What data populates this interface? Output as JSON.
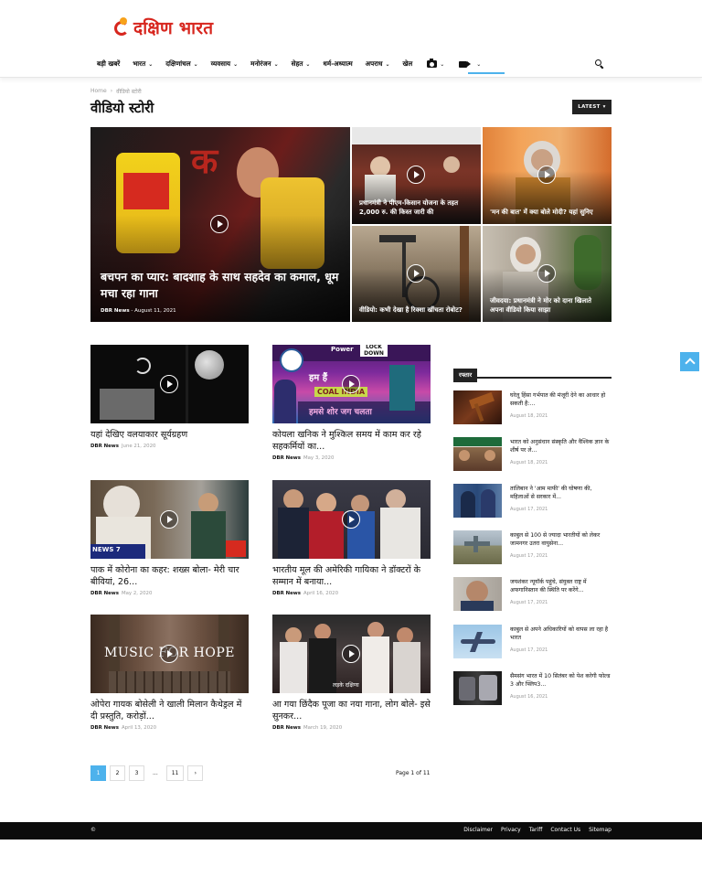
{
  "site": {
    "logo_text": "दक्षिण भारत"
  },
  "nav": {
    "items": [
      {
        "label": "बड़ी खबरें",
        "caret": false
      },
      {
        "label": "भारत",
        "caret": true
      },
      {
        "label": "दक्षिणांचल",
        "caret": true
      },
      {
        "label": "व्यवसाय",
        "caret": true
      },
      {
        "label": "मनोरंजन",
        "caret": true
      },
      {
        "label": "सेहत",
        "caret": true
      },
      {
        "label": "धर्म-अध्यात्म",
        "caret": false
      },
      {
        "label": "अपराध",
        "caret": true
      },
      {
        "label": "खेल",
        "caret": false
      }
    ],
    "caret_glyph": "⌄",
    "camera_icon": "camera-icon",
    "video_icon": "video-camera-icon",
    "search_icon": "search-icon"
  },
  "breadcrumb": {
    "home": "Home",
    "sep": "›",
    "current": "वीडियो स्टोरी"
  },
  "page_title": "वीडियो स्टोरी",
  "latest_button": {
    "label": "LATEST",
    "caret": "▾"
  },
  "hero": {
    "big": {
      "title": "बचपन का प्यार: बादशाह के साथ सहदेव का कमाल, धूम मचा रहा गाना",
      "author": "DBR News",
      "sep": "-",
      "date": "August 11, 2021"
    },
    "small": [
      {
        "title": "प्रधानमंत्री ने पीएम-किसान योजना के तहत 2,000 रु. की किस्त जारी की"
      },
      {
        "title": "'मन की बात' में क्या बोले मोदी? यहां सुनिए"
      },
      {
        "title": "वीडियो: कभी देखा है रिक्शा खींचता रोबोट?"
      },
      {
        "title": "जीवदया: प्रधानमंत्री ने मोर को दाना खिलाते अपना वीडियो किया साझा"
      }
    ]
  },
  "articles": [
    {
      "title": "यहां देखिए वलयाकार सूर्यग्रहण",
      "author": "DBR News",
      "date": "June 21, 2020"
    },
    {
      "title": "कोयला खनिक ने मुश्किल समय में काम कर रहे सहकर्मियों का...",
      "author": "DBR News",
      "date": "May 3, 2020"
    },
    {
      "title": "पाक में कोरोना का कहर: शख्स बोला- मेरी चार बीवियां, 26...",
      "author": "DBR News",
      "date": "May 2, 2020"
    },
    {
      "title": "भारतीय मूल की अमेरिकी गायिका ने डॉक्टरों के सम्मान में बनाया...",
      "author": "DBR News",
      "date": "April 16, 2020"
    },
    {
      "title": "ओपेरा गायक बोसेली ने खाली मिलान कैथेड्रल में दी प्रस्तुति, करोड़ों...",
      "author": "DBR News",
      "date": "April 13, 2020"
    },
    {
      "title": "आ गया छिंदैक पूजा का नया गाना, लोग बोले- इसे सुनकर...",
      "author": "DBR News",
      "date": "March 19, 2020"
    }
  ],
  "thumb_text": {
    "music_for_hope": "MUSIC FOR HOPE",
    "news7": "NEWS 7",
    "power": "Power",
    "lockdown": "LOCK DOWN",
    "coal": "COAL INDIA",
    "hum_hai": "हम हैं",
    "slogan": "हमसे शोर जग चलता",
    "chhindaik": "लड़के दक्षिणा"
  },
  "sidebar": {
    "heading": "रफ्तार",
    "items": [
      {
        "title": "घरेलू हिंसा गर्भपात की मंजूरी देने का आधार हो सकती है:...",
        "date": "August 18, 2021"
      },
      {
        "title": "भारत को अनुसंधान संस्कृति और वैश्विक ज्ञान के शीर्ष पर ले...",
        "date": "August 18, 2021"
      },
      {
        "title": "तालिबान ने 'आम माफी' की घोषणा की, महिलाओं से सरकार में...",
        "date": "August 17, 2021"
      },
      {
        "title": "काबुल से 100 से ज्यादा भारतीयों को लेकर जामनगर उतरा वायुसेना...",
        "date": "August 17, 2021"
      },
      {
        "title": "जयशंकर न्यूयॉर्क पहुंचे, संयुक्त राष्ट्र में अफगानिस्तान की स्थिति पर करेंगे...",
        "date": "August 17, 2021"
      },
      {
        "title": "काबुल से अपने अधिकारियों को वापस ला रहा है भारत",
        "date": "August 17, 2021"
      },
      {
        "title": "सैमसंग भारत में 10 सितंबर को पेश करेगी फोल्ड 3 और फ्लिप3...",
        "date": "August 16, 2021"
      }
    ]
  },
  "pagination": {
    "pages": [
      "1",
      "2",
      "3"
    ],
    "dots": "...",
    "last": "11",
    "next": "›",
    "info": "Page 1 of 11"
  },
  "footer": {
    "copyright": "©",
    "links": [
      "Disclaimer",
      "Privacy",
      "Tariff",
      "Contact Us",
      "Sitemap"
    ]
  },
  "colors": {
    "brand": "#d7261e",
    "accent": "#4db2ec",
    "dark": "#222222"
  }
}
